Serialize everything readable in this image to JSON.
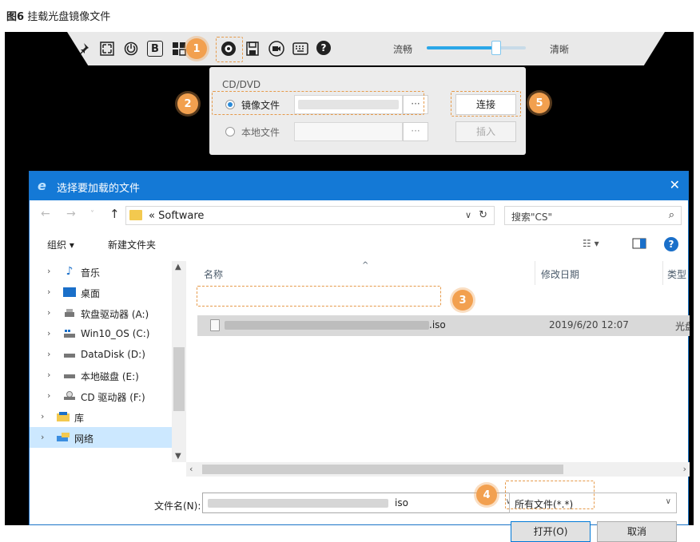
{
  "caption": {
    "fig": "图6",
    "text": "挂载光盘镜像文件"
  },
  "toolbar": {
    "left_label": "流畅",
    "right_label": "清晰",
    "b_label": "B",
    "help_glyph": "?",
    "slider_level_percent": 70
  },
  "badges": [
    "1",
    "2",
    "3",
    "4",
    "5"
  ],
  "cd_panel": {
    "title": "CD/DVD",
    "image_file_label": "镜像文件",
    "local_file_label": "本地文件",
    "browse_label": "···",
    "connect_label": "连接",
    "insert_label": "插入"
  },
  "dialog": {
    "title": "选择要加载的文件",
    "close": "✕",
    "address_prefix": "«",
    "address_path": "Software",
    "search_placeholder": "搜索\"CS\"",
    "organize": "组织 ▾",
    "new_folder": "新建文件夹",
    "tree": [
      {
        "label": "音乐"
      },
      {
        "label": "桌面"
      },
      {
        "label": "软盘驱动器 (A:)"
      },
      {
        "label": "Win10_OS (C:)"
      },
      {
        "label": "DataDisk (D:)"
      },
      {
        "label": "本地磁盘 (E:)"
      },
      {
        "label": "CD 驱动器 (F:)"
      },
      {
        "label": "库"
      },
      {
        "label": "网络"
      }
    ],
    "columns": {
      "name": "名称",
      "date": "修改日期",
      "type": "类型"
    },
    "file": {
      "name_suffix": ".iso",
      "date": "2019/6/20 12:07",
      "type": "光盘"
    },
    "filename_label": "文件名(N):",
    "filename_value": "iso",
    "filetype_value": "所有文件(*.*)",
    "open_label": "打开(O)",
    "cancel_label": "取消"
  },
  "colors": {
    "accent": "#1479d6",
    "badge": "#f2a04f",
    "dash": "#e69a4a",
    "selection": "#cce8ff"
  }
}
